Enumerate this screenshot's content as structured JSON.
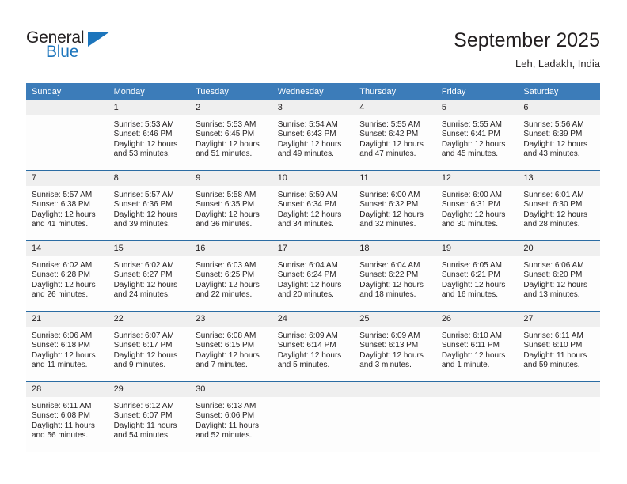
{
  "brand": {
    "name_part1": "General",
    "name_part2": "Blue",
    "accent_color": "#1c75bc"
  },
  "header": {
    "title": "September 2025",
    "subtitle": "Leh, Ladakh, India"
  },
  "calendar": {
    "header_bg": "#3c7cb9",
    "daynum_bg": "#efefef",
    "weekdays": [
      "Sunday",
      "Monday",
      "Tuesday",
      "Wednesday",
      "Thursday",
      "Friday",
      "Saturday"
    ],
    "weeks": [
      [
        {
          "day": "",
          "sunrise": "",
          "sunset": "",
          "daylight_line1": "",
          "daylight_line2": ""
        },
        {
          "day": "1",
          "sunrise": "Sunrise: 5:53 AM",
          "sunset": "Sunset: 6:46 PM",
          "daylight_line1": "Daylight: 12 hours",
          "daylight_line2": "and 53 minutes."
        },
        {
          "day": "2",
          "sunrise": "Sunrise: 5:53 AM",
          "sunset": "Sunset: 6:45 PM",
          "daylight_line1": "Daylight: 12 hours",
          "daylight_line2": "and 51 minutes."
        },
        {
          "day": "3",
          "sunrise": "Sunrise: 5:54 AM",
          "sunset": "Sunset: 6:43 PM",
          "daylight_line1": "Daylight: 12 hours",
          "daylight_line2": "and 49 minutes."
        },
        {
          "day": "4",
          "sunrise": "Sunrise: 5:55 AM",
          "sunset": "Sunset: 6:42 PM",
          "daylight_line1": "Daylight: 12 hours",
          "daylight_line2": "and 47 minutes."
        },
        {
          "day": "5",
          "sunrise": "Sunrise: 5:55 AM",
          "sunset": "Sunset: 6:41 PM",
          "daylight_line1": "Daylight: 12 hours",
          "daylight_line2": "and 45 minutes."
        },
        {
          "day": "6",
          "sunrise": "Sunrise: 5:56 AM",
          "sunset": "Sunset: 6:39 PM",
          "daylight_line1": "Daylight: 12 hours",
          "daylight_line2": "and 43 minutes."
        }
      ],
      [
        {
          "day": "7",
          "sunrise": "Sunrise: 5:57 AM",
          "sunset": "Sunset: 6:38 PM",
          "daylight_line1": "Daylight: 12 hours",
          "daylight_line2": "and 41 minutes."
        },
        {
          "day": "8",
          "sunrise": "Sunrise: 5:57 AM",
          "sunset": "Sunset: 6:36 PM",
          "daylight_line1": "Daylight: 12 hours",
          "daylight_line2": "and 39 minutes."
        },
        {
          "day": "9",
          "sunrise": "Sunrise: 5:58 AM",
          "sunset": "Sunset: 6:35 PM",
          "daylight_line1": "Daylight: 12 hours",
          "daylight_line2": "and 36 minutes."
        },
        {
          "day": "10",
          "sunrise": "Sunrise: 5:59 AM",
          "sunset": "Sunset: 6:34 PM",
          "daylight_line1": "Daylight: 12 hours",
          "daylight_line2": "and 34 minutes."
        },
        {
          "day": "11",
          "sunrise": "Sunrise: 6:00 AM",
          "sunset": "Sunset: 6:32 PM",
          "daylight_line1": "Daylight: 12 hours",
          "daylight_line2": "and 32 minutes."
        },
        {
          "day": "12",
          "sunrise": "Sunrise: 6:00 AM",
          "sunset": "Sunset: 6:31 PM",
          "daylight_line1": "Daylight: 12 hours",
          "daylight_line2": "and 30 minutes."
        },
        {
          "day": "13",
          "sunrise": "Sunrise: 6:01 AM",
          "sunset": "Sunset: 6:30 PM",
          "daylight_line1": "Daylight: 12 hours",
          "daylight_line2": "and 28 minutes."
        }
      ],
      [
        {
          "day": "14",
          "sunrise": "Sunrise: 6:02 AM",
          "sunset": "Sunset: 6:28 PM",
          "daylight_line1": "Daylight: 12 hours",
          "daylight_line2": "and 26 minutes."
        },
        {
          "day": "15",
          "sunrise": "Sunrise: 6:02 AM",
          "sunset": "Sunset: 6:27 PM",
          "daylight_line1": "Daylight: 12 hours",
          "daylight_line2": "and 24 minutes."
        },
        {
          "day": "16",
          "sunrise": "Sunrise: 6:03 AM",
          "sunset": "Sunset: 6:25 PM",
          "daylight_line1": "Daylight: 12 hours",
          "daylight_line2": "and 22 minutes."
        },
        {
          "day": "17",
          "sunrise": "Sunrise: 6:04 AM",
          "sunset": "Sunset: 6:24 PM",
          "daylight_line1": "Daylight: 12 hours",
          "daylight_line2": "and 20 minutes."
        },
        {
          "day": "18",
          "sunrise": "Sunrise: 6:04 AM",
          "sunset": "Sunset: 6:22 PM",
          "daylight_line1": "Daylight: 12 hours",
          "daylight_line2": "and 18 minutes."
        },
        {
          "day": "19",
          "sunrise": "Sunrise: 6:05 AM",
          "sunset": "Sunset: 6:21 PM",
          "daylight_line1": "Daylight: 12 hours",
          "daylight_line2": "and 16 minutes."
        },
        {
          "day": "20",
          "sunrise": "Sunrise: 6:06 AM",
          "sunset": "Sunset: 6:20 PM",
          "daylight_line1": "Daylight: 12 hours",
          "daylight_line2": "and 13 minutes."
        }
      ],
      [
        {
          "day": "21",
          "sunrise": "Sunrise: 6:06 AM",
          "sunset": "Sunset: 6:18 PM",
          "daylight_line1": "Daylight: 12 hours",
          "daylight_line2": "and 11 minutes."
        },
        {
          "day": "22",
          "sunrise": "Sunrise: 6:07 AM",
          "sunset": "Sunset: 6:17 PM",
          "daylight_line1": "Daylight: 12 hours",
          "daylight_line2": "and 9 minutes."
        },
        {
          "day": "23",
          "sunrise": "Sunrise: 6:08 AM",
          "sunset": "Sunset: 6:15 PM",
          "daylight_line1": "Daylight: 12 hours",
          "daylight_line2": "and 7 minutes."
        },
        {
          "day": "24",
          "sunrise": "Sunrise: 6:09 AM",
          "sunset": "Sunset: 6:14 PM",
          "daylight_line1": "Daylight: 12 hours",
          "daylight_line2": "and 5 minutes."
        },
        {
          "day": "25",
          "sunrise": "Sunrise: 6:09 AM",
          "sunset": "Sunset: 6:13 PM",
          "daylight_line1": "Daylight: 12 hours",
          "daylight_line2": "and 3 minutes."
        },
        {
          "day": "26",
          "sunrise": "Sunrise: 6:10 AM",
          "sunset": "Sunset: 6:11 PM",
          "daylight_line1": "Daylight: 12 hours",
          "daylight_line2": "and 1 minute."
        },
        {
          "day": "27",
          "sunrise": "Sunrise: 6:11 AM",
          "sunset": "Sunset: 6:10 PM",
          "daylight_line1": "Daylight: 11 hours",
          "daylight_line2": "and 59 minutes."
        }
      ],
      [
        {
          "day": "28",
          "sunrise": "Sunrise: 6:11 AM",
          "sunset": "Sunset: 6:08 PM",
          "daylight_line1": "Daylight: 11 hours",
          "daylight_line2": "and 56 minutes."
        },
        {
          "day": "29",
          "sunrise": "Sunrise: 6:12 AM",
          "sunset": "Sunset: 6:07 PM",
          "daylight_line1": "Daylight: 11 hours",
          "daylight_line2": "and 54 minutes."
        },
        {
          "day": "30",
          "sunrise": "Sunrise: 6:13 AM",
          "sunset": "Sunset: 6:06 PM",
          "daylight_line1": "Daylight: 11 hours",
          "daylight_line2": "and 52 minutes."
        },
        {
          "day": "",
          "sunrise": "",
          "sunset": "",
          "daylight_line1": "",
          "daylight_line2": ""
        },
        {
          "day": "",
          "sunrise": "",
          "sunset": "",
          "daylight_line1": "",
          "daylight_line2": ""
        },
        {
          "day": "",
          "sunrise": "",
          "sunset": "",
          "daylight_line1": "",
          "daylight_line2": ""
        },
        {
          "day": "",
          "sunrise": "",
          "sunset": "",
          "daylight_line1": "",
          "daylight_line2": ""
        }
      ]
    ]
  }
}
